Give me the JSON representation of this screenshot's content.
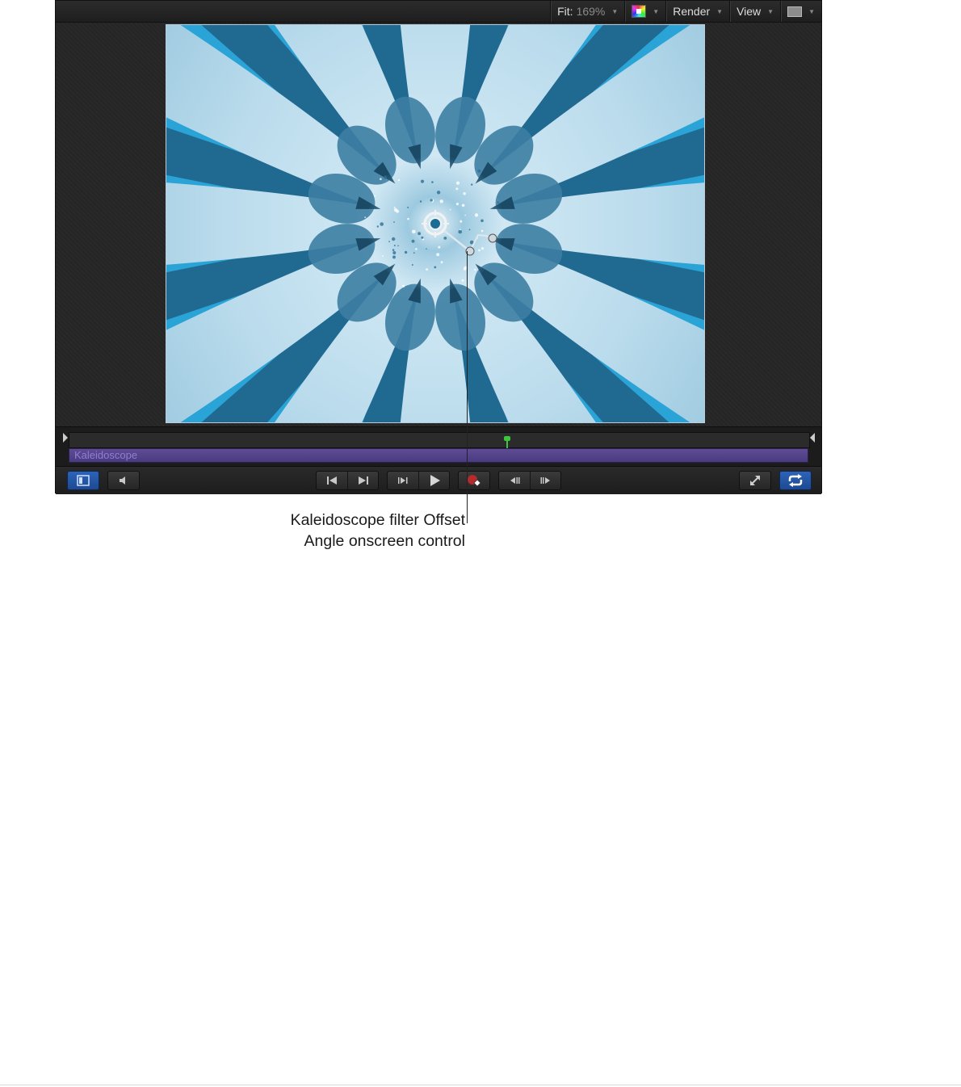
{
  "toolbar": {
    "fit_label": "Fit:",
    "fit_value": "169%",
    "color_icon": "color-channels-icon",
    "render_label": "Render",
    "view_label": "View",
    "layout_icon": "view-layout-icon"
  },
  "timeline": {
    "clip_name": "Kaleidoscope",
    "playhead_color": "#3ec43e",
    "clip_color": "#5e4d95"
  },
  "transport": {
    "buttons": [
      {
        "name": "show-hide-timeline",
        "icon": "timeline-toggle-icon",
        "active": true
      },
      {
        "name": "audio",
        "icon": "speaker-icon",
        "active": false
      },
      {
        "name": "go-to-start",
        "icon": "go-to-start-icon"
      },
      {
        "name": "go-to-end",
        "icon": "go-to-end-icon"
      },
      {
        "name": "step-to-frame",
        "icon": "step-frame-icon"
      },
      {
        "name": "play",
        "icon": "play-icon"
      },
      {
        "name": "record",
        "icon": "record-keyframe-icon"
      },
      {
        "name": "previous-frame",
        "icon": "previous-frame-icon"
      },
      {
        "name": "next-frame",
        "icon": "next-frame-icon"
      },
      {
        "name": "full-screen",
        "icon": "expand-icon"
      },
      {
        "name": "loop",
        "icon": "loop-icon",
        "active": true
      }
    ]
  },
  "callout": {
    "line1": "Kaleidoscope filter Offset",
    "line2": "Angle onscreen control"
  },
  "colors": {
    "canvas_base": "#2aa3d6",
    "accent_blue": "#2e63b8"
  }
}
